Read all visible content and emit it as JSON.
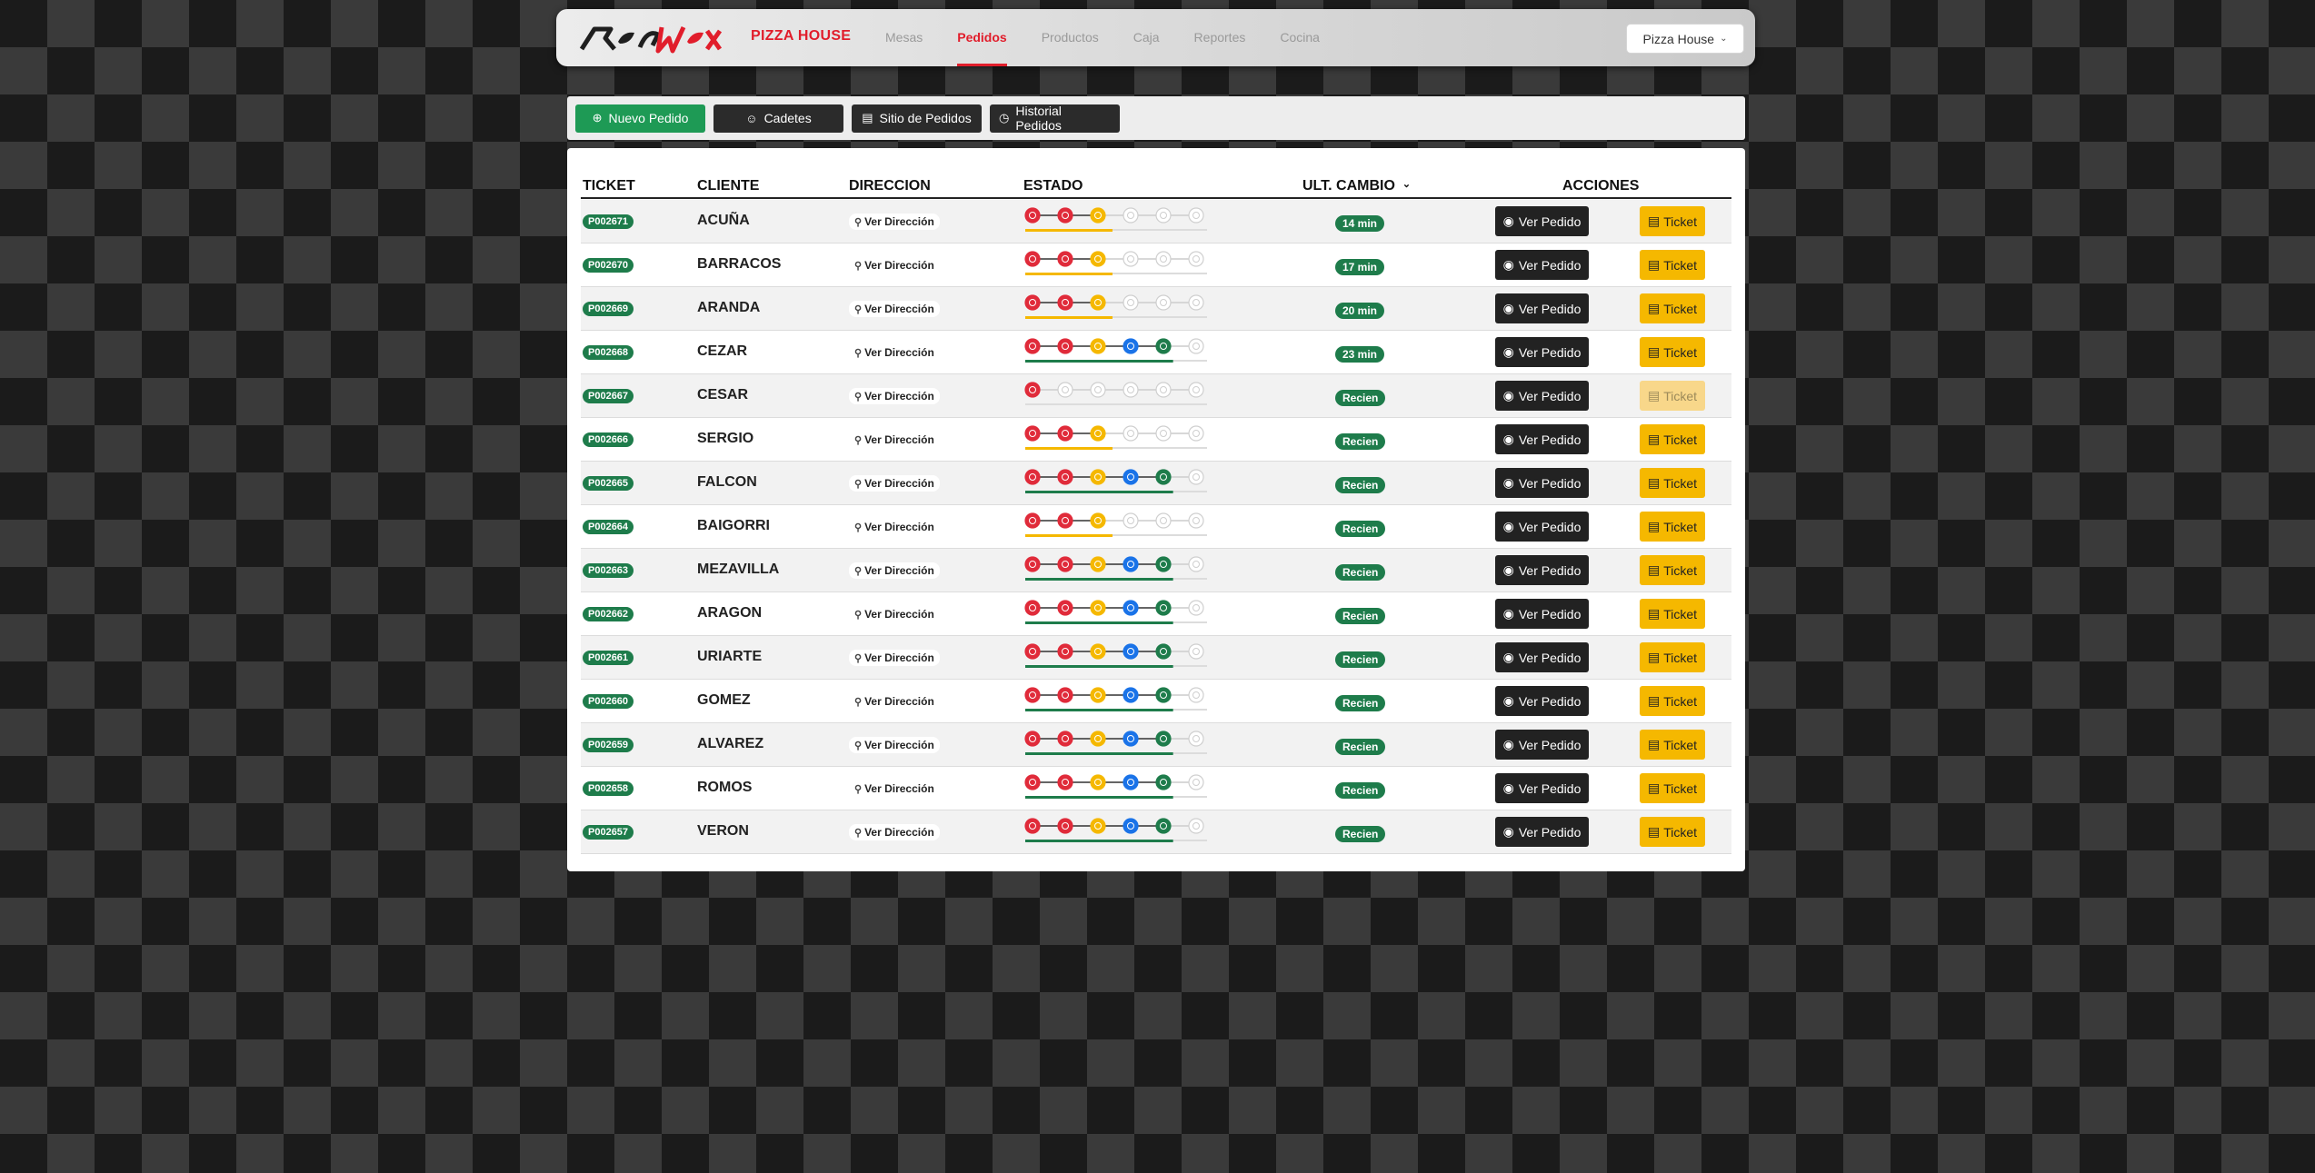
{
  "navbar": {
    "brand": "PIZZA HOUSE",
    "links": [
      {
        "label": "Mesas",
        "active": false
      },
      {
        "label": "Pedidos",
        "active": true
      },
      {
        "label": "Productos",
        "active": false
      },
      {
        "label": "Caja",
        "active": false
      },
      {
        "label": "Reportes",
        "active": false
      },
      {
        "label": "Cocina",
        "active": false
      }
    ],
    "venue_select": "Pizza House"
  },
  "toolbar": {
    "new_order": "Nuevo Pedido",
    "couriers": "Cadetes",
    "order_site": "Sitio de Pedidos",
    "order_history": "Historial Pedidos"
  },
  "table": {
    "headers": {
      "ticket": "TICKET",
      "client": "CLIENTE",
      "address": "DIRECCION",
      "status": "ESTADO",
      "last_change": "ULT. CAMBIO",
      "actions": "ACCIONES"
    },
    "view_address_label": "Ver Dirección",
    "view_order_label": "Ver Pedido",
    "ticket_button_label": "Ticket",
    "status_icons": [
      "clock-icon",
      "alert-icon",
      "fire-icon",
      "box-icon",
      "delivery-truck-icon",
      "check-icon"
    ],
    "status_colors": [
      "#e02b3a",
      "#e02b3a",
      "#f5b800",
      "#1a73e8",
      "#1e7c4b",
      "#1e7c4b"
    ],
    "rows": [
      {
        "ticket": "P002671",
        "client": "ACUÑA",
        "steps": 3,
        "elapsed": "14 min",
        "ticket_enabled": true
      },
      {
        "ticket": "P002670",
        "client": "BARRACOS",
        "steps": 3,
        "elapsed": "17 min",
        "ticket_enabled": true
      },
      {
        "ticket": "P002669",
        "client": "ARANDA",
        "steps": 3,
        "elapsed": "20 min",
        "ticket_enabled": true
      },
      {
        "ticket": "P002668",
        "client": "CEZAR",
        "steps": 5,
        "elapsed": "23 min",
        "ticket_enabled": true
      },
      {
        "ticket": "P002667",
        "client": "CESAR",
        "steps": 1,
        "elapsed": "Recien",
        "ticket_enabled": false
      },
      {
        "ticket": "P002666",
        "client": "SERGIO",
        "steps": 3,
        "elapsed": "Recien",
        "ticket_enabled": true
      },
      {
        "ticket": "P002665",
        "client": "FALCON",
        "steps": 5,
        "elapsed": "Recien",
        "ticket_enabled": true
      },
      {
        "ticket": "P002664",
        "client": "BAIGORRI",
        "steps": 3,
        "elapsed": "Recien",
        "ticket_enabled": true
      },
      {
        "ticket": "P002663",
        "client": "MEZAVILLA",
        "steps": 5,
        "elapsed": "Recien",
        "ticket_enabled": true
      },
      {
        "ticket": "P002662",
        "client": "ARAGON",
        "steps": 5,
        "elapsed": "Recien",
        "ticket_enabled": true
      },
      {
        "ticket": "P002661",
        "client": "URIARTE",
        "steps": 5,
        "elapsed": "Recien",
        "ticket_enabled": true
      },
      {
        "ticket": "P002660",
        "client": "GOMEZ",
        "steps": 5,
        "elapsed": "Recien",
        "ticket_enabled": true
      },
      {
        "ticket": "P002659",
        "client": "ALVAREZ",
        "steps": 5,
        "elapsed": "Recien",
        "ticket_enabled": true
      },
      {
        "ticket": "P002658",
        "client": "ROMOS",
        "steps": 5,
        "elapsed": "Recien",
        "ticket_enabled": true
      },
      {
        "ticket": "P002657",
        "client": "VERON",
        "steps": 5,
        "elapsed": "Recien",
        "ticket_enabled": true
      }
    ]
  }
}
